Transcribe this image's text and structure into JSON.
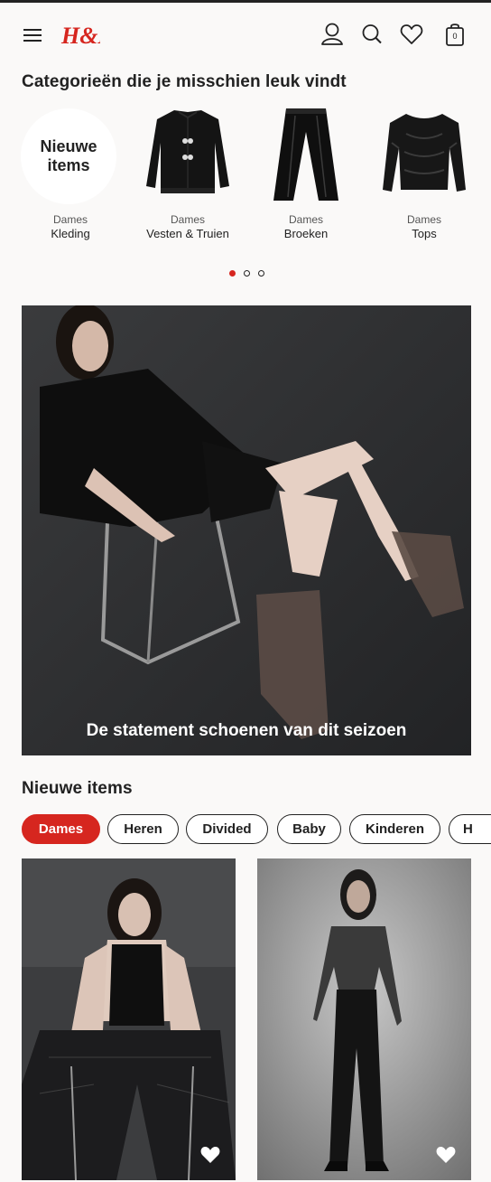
{
  "header": {
    "menu_icon": "hamburger-menu-icon",
    "logo_text": "H&M",
    "account_icon": "user-icon",
    "search_icon": "search-icon",
    "favorites_icon": "heart-icon",
    "bag_icon": "shopping-bag-icon",
    "bag_count": "0",
    "brand_color": "#d6261f"
  },
  "categories": {
    "title": "Categorieën die je misschien leuk vindt",
    "items": [
      {
        "circle_text": "Nieuwe items",
        "sub": "Dames",
        "label": "Kleding"
      },
      {
        "sub": "Dames",
        "label": "Vesten & Truien"
      },
      {
        "sub": "Dames",
        "label": "Broeken"
      },
      {
        "sub": "Dames",
        "label": "Tops"
      }
    ],
    "active_dot": 0,
    "dot_count": 3
  },
  "hero": {
    "caption": "De statement schoenen van dit seizoen"
  },
  "new_items": {
    "title": "Nieuwe items",
    "filters": [
      "Dames",
      "Heren",
      "Divided",
      "Baby",
      "Kinderen",
      "H"
    ],
    "active_filter": "Dames",
    "active_color": "#d6261f"
  }
}
